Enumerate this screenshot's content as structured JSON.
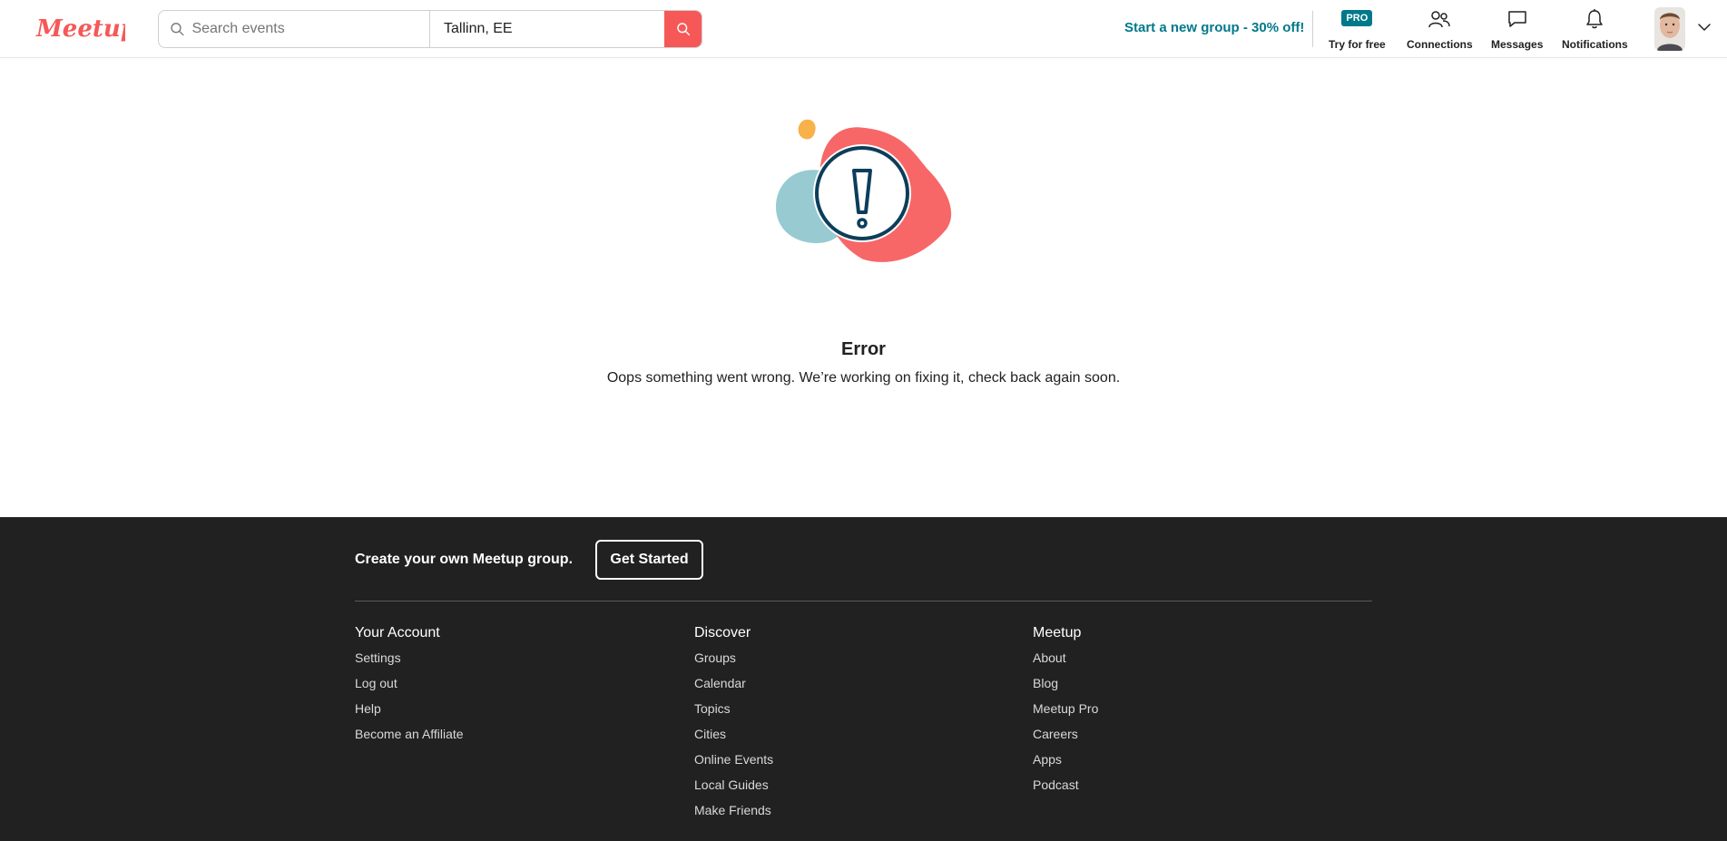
{
  "header": {
    "logo_text": "Meetup",
    "search": {
      "placeholder": "Search events",
      "location": "Tallinn, EE"
    },
    "promo_link": "Start a new group - 30% off!",
    "pro_badge": "PRO",
    "nav": {
      "try_free": "Try for free",
      "connections": "Connections",
      "messages": "Messages",
      "notifications": "Notifications"
    }
  },
  "error": {
    "title": "Error",
    "message": "Oops something went wrong. We’re working on fixing it, check back again soon."
  },
  "footer": {
    "cta_text": "Create your own Meetup group.",
    "cta_button": "Get Started",
    "columns": [
      {
        "heading": "Your Account",
        "links": [
          "Settings",
          "Log out",
          "Help",
          "Become an Affiliate"
        ]
      },
      {
        "heading": "Discover",
        "links": [
          "Groups",
          "Calendar",
          "Topics",
          "Cities",
          "Online Events",
          "Local Guides",
          "Make Friends"
        ]
      },
      {
        "heading": "Meetup",
        "links": [
          "About",
          "Blog",
          "Meetup Pro",
          "Careers",
          "Apps",
          "Podcast"
        ]
      }
    ]
  },
  "colors": {
    "brand": "#f65858",
    "teal": "#00798a",
    "footer_bg": "#212121",
    "blob_blue": "#97cad1",
    "blob_yellow": "#f9b14a",
    "icon_navy": "#0c3e5a"
  }
}
